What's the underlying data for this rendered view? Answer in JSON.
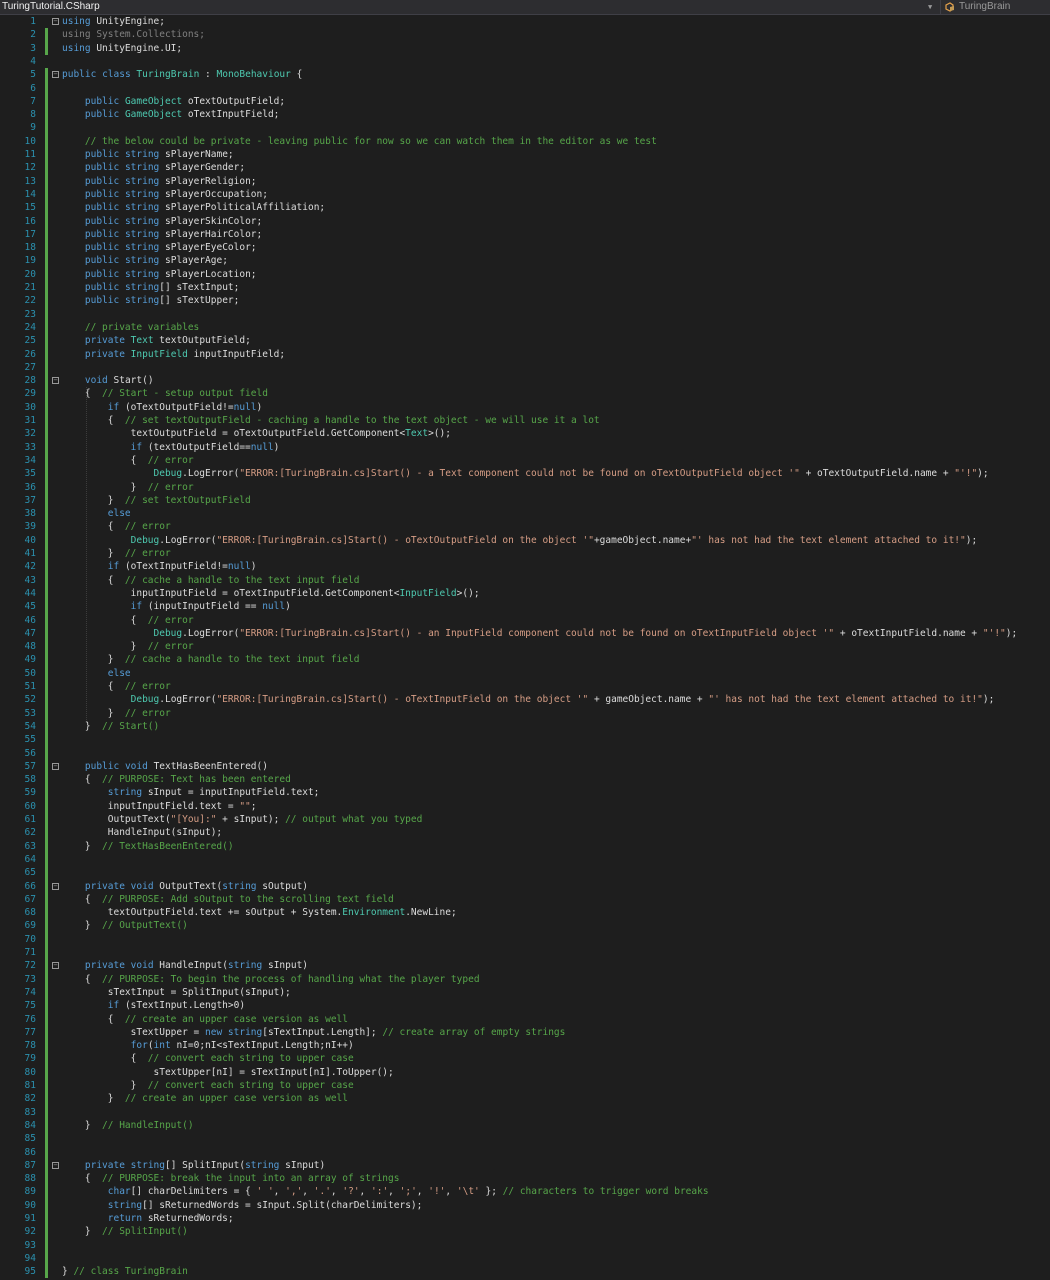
{
  "editor": {
    "file_label": "TuringTutorial.CSharp",
    "class_label": "TuringBrain",
    "class_icon": "class-icon",
    "colors": {
      "background": "#1e1e1e",
      "keyword": "#569cd6",
      "type": "#4ec9b0",
      "string": "#d69d85",
      "comment": "#57a64a",
      "line_number": "#2b91af",
      "text": "#dcdcdc"
    }
  },
  "code_lines": [
    [
      [
        "k",
        "using"
      ],
      [
        "p",
        " UnityEngine;"
      ]
    ],
    [
      [
        "g",
        "using System.Collections;"
      ]
    ],
    [
      [
        "k",
        "using"
      ],
      [
        "p",
        " UnityEngine.UI;"
      ]
    ],
    [],
    [
      [
        "k",
        "public"
      ],
      [
        "p",
        " "
      ],
      [
        "k",
        "class"
      ],
      [
        "p",
        " "
      ],
      [
        "t",
        "TuringBrain"
      ],
      [
        "p",
        " : "
      ],
      [
        "t",
        "MonoBehaviour"
      ],
      [
        "p",
        " {"
      ]
    ],
    [],
    [
      [
        "p",
        "    "
      ],
      [
        "k",
        "public"
      ],
      [
        "p",
        " "
      ],
      [
        "t",
        "GameObject"
      ],
      [
        "p",
        " oTextOutputField;"
      ]
    ],
    [
      [
        "p",
        "    "
      ],
      [
        "k",
        "public"
      ],
      [
        "p",
        " "
      ],
      [
        "t",
        "GameObject"
      ],
      [
        "p",
        " oTextInputField;"
      ]
    ],
    [],
    [
      [
        "p",
        "    "
      ],
      [
        "c",
        "// the below could be private - leaving public for now so we can watch them in the editor as we test"
      ]
    ],
    [
      [
        "p",
        "    "
      ],
      [
        "k",
        "public"
      ],
      [
        "p",
        " "
      ],
      [
        "k",
        "string"
      ],
      [
        "p",
        " sPlayerName;"
      ]
    ],
    [
      [
        "p",
        "    "
      ],
      [
        "k",
        "public"
      ],
      [
        "p",
        " "
      ],
      [
        "k",
        "string"
      ],
      [
        "p",
        " sPlayerGender;"
      ]
    ],
    [
      [
        "p",
        "    "
      ],
      [
        "k",
        "public"
      ],
      [
        "p",
        " "
      ],
      [
        "k",
        "string"
      ],
      [
        "p",
        " sPlayerReligion;"
      ]
    ],
    [
      [
        "p",
        "    "
      ],
      [
        "k",
        "public"
      ],
      [
        "p",
        " "
      ],
      [
        "k",
        "string"
      ],
      [
        "p",
        " sPlayerOccupation;"
      ]
    ],
    [
      [
        "p",
        "    "
      ],
      [
        "k",
        "public"
      ],
      [
        "p",
        " "
      ],
      [
        "k",
        "string"
      ],
      [
        "p",
        " sPlayerPoliticalAffiliation;"
      ]
    ],
    [
      [
        "p",
        "    "
      ],
      [
        "k",
        "public"
      ],
      [
        "p",
        " "
      ],
      [
        "k",
        "string"
      ],
      [
        "p",
        " sPlayerSkinColor;"
      ]
    ],
    [
      [
        "p",
        "    "
      ],
      [
        "k",
        "public"
      ],
      [
        "p",
        " "
      ],
      [
        "k",
        "string"
      ],
      [
        "p",
        " sPlayerHairColor;"
      ]
    ],
    [
      [
        "p",
        "    "
      ],
      [
        "k",
        "public"
      ],
      [
        "p",
        " "
      ],
      [
        "k",
        "string"
      ],
      [
        "p",
        " sPlayerEyeColor;"
      ]
    ],
    [
      [
        "p",
        "    "
      ],
      [
        "k",
        "public"
      ],
      [
        "p",
        " "
      ],
      [
        "k",
        "string"
      ],
      [
        "p",
        " sPlayerAge;"
      ]
    ],
    [
      [
        "p",
        "    "
      ],
      [
        "k",
        "public"
      ],
      [
        "p",
        " "
      ],
      [
        "k",
        "string"
      ],
      [
        "p",
        " sPlayerLocation;"
      ]
    ],
    [
      [
        "p",
        "    "
      ],
      [
        "k",
        "public"
      ],
      [
        "p",
        " "
      ],
      [
        "k",
        "string"
      ],
      [
        "p",
        "[] sTextInput;"
      ]
    ],
    [
      [
        "p",
        "    "
      ],
      [
        "k",
        "public"
      ],
      [
        "p",
        " "
      ],
      [
        "k",
        "string"
      ],
      [
        "p",
        "[] sTextUpper;"
      ]
    ],
    [],
    [
      [
        "p",
        "    "
      ],
      [
        "c",
        "// private variables"
      ]
    ],
    [
      [
        "p",
        "    "
      ],
      [
        "k",
        "private"
      ],
      [
        "p",
        " "
      ],
      [
        "t",
        "Text"
      ],
      [
        "p",
        " textOutputField;"
      ]
    ],
    [
      [
        "p",
        "    "
      ],
      [
        "k",
        "private"
      ],
      [
        "p",
        " "
      ],
      [
        "t",
        "InputField"
      ],
      [
        "p",
        " inputInputField;"
      ]
    ],
    [],
    [
      [
        "p",
        "    "
      ],
      [
        "k",
        "void"
      ],
      [
        "p",
        " Start()"
      ]
    ],
    [
      [
        "p",
        "    {  "
      ],
      [
        "c",
        "// Start - setup output field"
      ]
    ],
    [
      [
        "p",
        "        "
      ],
      [
        "k",
        "if"
      ],
      [
        "p",
        " (oTextOutputField!="
      ],
      [
        "k",
        "null"
      ],
      [
        "p",
        ")"
      ]
    ],
    [
      [
        "p",
        "        {  "
      ],
      [
        "c",
        "// set textOutputField - caching a handle to the text object - we will use it a lot"
      ]
    ],
    [
      [
        "p",
        "            textOutputField = oTextOutputField.GetComponent<"
      ],
      [
        "t",
        "Text"
      ],
      [
        "p",
        ">();"
      ]
    ],
    [
      [
        "p",
        "            "
      ],
      [
        "k",
        "if"
      ],
      [
        "p",
        " (textOutputField=="
      ],
      [
        "k",
        "null"
      ],
      [
        "p",
        ")"
      ]
    ],
    [
      [
        "p",
        "            {  "
      ],
      [
        "c",
        "// error"
      ]
    ],
    [
      [
        "p",
        "                "
      ],
      [
        "t",
        "Debug"
      ],
      [
        "p",
        ".LogError("
      ],
      [
        "s",
        "\"ERROR:[TuringBrain.cs]Start() - a Text component could not be found on oTextOutputField object '\""
      ],
      [
        "p",
        " + oTextOutputField.name + "
      ],
      [
        "s",
        "\"'!\""
      ],
      [
        "p",
        ");"
      ]
    ],
    [
      [
        "p",
        "            }  "
      ],
      [
        "c",
        "// error"
      ]
    ],
    [
      [
        "p",
        "        }  "
      ],
      [
        "c",
        "// set textOutputField"
      ]
    ],
    [
      [
        "p",
        "        "
      ],
      [
        "k",
        "else"
      ]
    ],
    [
      [
        "p",
        "        {  "
      ],
      [
        "c",
        "// error"
      ]
    ],
    [
      [
        "p",
        "            "
      ],
      [
        "t",
        "Debug"
      ],
      [
        "p",
        ".LogError("
      ],
      [
        "s",
        "\"ERROR:[TuringBrain.cs]Start() - oTextOutputField on the object '\""
      ],
      [
        "p",
        "+gameObject.name+"
      ],
      [
        "s",
        "\"' has not had the text element attached to it!\""
      ],
      [
        "p",
        ");"
      ]
    ],
    [
      [
        "p",
        "        }  "
      ],
      [
        "c",
        "// error"
      ]
    ],
    [
      [
        "p",
        "        "
      ],
      [
        "k",
        "if"
      ],
      [
        "p",
        " (oTextInputField!="
      ],
      [
        "k",
        "null"
      ],
      [
        "p",
        ")"
      ]
    ],
    [
      [
        "p",
        "        {  "
      ],
      [
        "c",
        "// cache a handle to the text input field"
      ]
    ],
    [
      [
        "p",
        "            inputInputField = oTextInputField.GetComponent<"
      ],
      [
        "t",
        "InputField"
      ],
      [
        "p",
        ">();"
      ]
    ],
    [
      [
        "p",
        "            "
      ],
      [
        "k",
        "if"
      ],
      [
        "p",
        " (inputInputField == "
      ],
      [
        "k",
        "null"
      ],
      [
        "p",
        ")"
      ]
    ],
    [
      [
        "p",
        "            {  "
      ],
      [
        "c",
        "// error"
      ]
    ],
    [
      [
        "p",
        "                "
      ],
      [
        "t",
        "Debug"
      ],
      [
        "p",
        ".LogError("
      ],
      [
        "s",
        "\"ERROR:[TuringBrain.cs]Start() - an InputField component could not be found on oTextInputField object '\""
      ],
      [
        "p",
        " + oTextInputField.name + "
      ],
      [
        "s",
        "\"'!\""
      ],
      [
        "p",
        ");"
      ]
    ],
    [
      [
        "p",
        "            }  "
      ],
      [
        "c",
        "// error"
      ]
    ],
    [
      [
        "p",
        "        }  "
      ],
      [
        "c",
        "// cache a handle to the text input field"
      ]
    ],
    [
      [
        "p",
        "        "
      ],
      [
        "k",
        "else"
      ]
    ],
    [
      [
        "p",
        "        {  "
      ],
      [
        "c",
        "// error"
      ]
    ],
    [
      [
        "p",
        "            "
      ],
      [
        "t",
        "Debug"
      ],
      [
        "p",
        ".LogError("
      ],
      [
        "s",
        "\"ERROR:[TuringBrain.cs]Start() - oTextInputField on the object '\""
      ],
      [
        "p",
        " + gameObject.name + "
      ],
      [
        "s",
        "\"' has not had the text element attached to it!\""
      ],
      [
        "p",
        ");"
      ]
    ],
    [
      [
        "p",
        "        }  "
      ],
      [
        "c",
        "// error"
      ]
    ],
    [
      [
        "p",
        "    }  "
      ],
      [
        "c",
        "// Start()"
      ]
    ],
    [],
    [],
    [
      [
        "p",
        "    "
      ],
      [
        "k",
        "public"
      ],
      [
        "p",
        " "
      ],
      [
        "k",
        "void"
      ],
      [
        "p",
        " TextHasBeenEntered()"
      ]
    ],
    [
      [
        "p",
        "    {  "
      ],
      [
        "c",
        "// PURPOSE: Text has been entered"
      ]
    ],
    [
      [
        "p",
        "        "
      ],
      [
        "k",
        "string"
      ],
      [
        "p",
        " sInput = inputInputField.text;"
      ]
    ],
    [
      [
        "p",
        "        inputInputField.text = "
      ],
      [
        "s",
        "\"\""
      ],
      [
        "p",
        ";"
      ]
    ],
    [
      [
        "p",
        "        OutputText("
      ],
      [
        "s",
        "\"[You]:\""
      ],
      [
        "p",
        " + sInput); "
      ],
      [
        "c",
        "// output what you typed"
      ]
    ],
    [
      [
        "p",
        "        HandleInput(sInput);"
      ]
    ],
    [
      [
        "p",
        "    }  "
      ],
      [
        "c",
        "// TextHasBeenEntered()"
      ]
    ],
    [],
    [],
    [
      [
        "p",
        "    "
      ],
      [
        "k",
        "private"
      ],
      [
        "p",
        " "
      ],
      [
        "k",
        "void"
      ],
      [
        "p",
        " OutputText("
      ],
      [
        "k",
        "string"
      ],
      [
        "p",
        " sOutput)"
      ]
    ],
    [
      [
        "p",
        "    {  "
      ],
      [
        "c",
        "// PURPOSE: Add sOutput to the scrolling text field"
      ]
    ],
    [
      [
        "p",
        "        textOutputField.text += sOutput + System."
      ],
      [
        "t",
        "Environment"
      ],
      [
        "p",
        ".NewLine;"
      ]
    ],
    [
      [
        "p",
        "    }  "
      ],
      [
        "c",
        "// OutputText()"
      ]
    ],
    [],
    [],
    [
      [
        "p",
        "    "
      ],
      [
        "k",
        "private"
      ],
      [
        "p",
        " "
      ],
      [
        "k",
        "void"
      ],
      [
        "p",
        " HandleInput("
      ],
      [
        "k",
        "string"
      ],
      [
        "p",
        " sInput)"
      ]
    ],
    [
      [
        "p",
        "    {  "
      ],
      [
        "c",
        "// PURPOSE: To begin the process of handling what the player typed"
      ]
    ],
    [
      [
        "p",
        "        sTextInput = SplitInput(sInput);"
      ]
    ],
    [
      [
        "p",
        "        "
      ],
      [
        "k",
        "if"
      ],
      [
        "p",
        " (sTextInput.Length>0)"
      ]
    ],
    [
      [
        "p",
        "        {  "
      ],
      [
        "c",
        "// create an upper case version as well"
      ]
    ],
    [
      [
        "p",
        "            sTextUpper = "
      ],
      [
        "k",
        "new"
      ],
      [
        "p",
        " "
      ],
      [
        "k",
        "string"
      ],
      [
        "p",
        "[sTextInput.Length]; "
      ],
      [
        "c",
        "// create array of empty strings"
      ]
    ],
    [
      [
        "p",
        "            "
      ],
      [
        "k",
        "for"
      ],
      [
        "p",
        "("
      ],
      [
        "k",
        "int"
      ],
      [
        "p",
        " nI=0;nI<sTextInput.Length;nI++)"
      ]
    ],
    [
      [
        "p",
        "            {  "
      ],
      [
        "c",
        "// convert each string to upper case"
      ]
    ],
    [
      [
        "p",
        "                sTextUpper[nI] = sTextInput[nI].ToUpper();"
      ]
    ],
    [
      [
        "p",
        "            }  "
      ],
      [
        "c",
        "// convert each string to upper case"
      ]
    ],
    [
      [
        "p",
        "        }  "
      ],
      [
        "c",
        "// create an upper case version as well"
      ]
    ],
    [],
    [
      [
        "p",
        "    }  "
      ],
      [
        "c",
        "// HandleInput()"
      ]
    ],
    [],
    [],
    [
      [
        "p",
        "    "
      ],
      [
        "k",
        "private"
      ],
      [
        "p",
        " "
      ],
      [
        "k",
        "string"
      ],
      [
        "p",
        "[] SplitInput("
      ],
      [
        "k",
        "string"
      ],
      [
        "p",
        " sInput)"
      ]
    ],
    [
      [
        "p",
        "    {  "
      ],
      [
        "c",
        "// PURPOSE: break the input into an array of strings"
      ]
    ],
    [
      [
        "p",
        "        "
      ],
      [
        "k",
        "char"
      ],
      [
        "p",
        "[] charDelimiters = { "
      ],
      [
        "s",
        "' '"
      ],
      [
        "p",
        ", "
      ],
      [
        "s",
        "','"
      ],
      [
        "p",
        ", "
      ],
      [
        "s",
        "'.'"
      ],
      [
        "p",
        ", "
      ],
      [
        "s",
        "'?'"
      ],
      [
        "p",
        ", "
      ],
      [
        "s",
        "':'"
      ],
      [
        "p",
        ", "
      ],
      [
        "s",
        "';'"
      ],
      [
        "p",
        ", "
      ],
      [
        "s",
        "'!'"
      ],
      [
        "p",
        ", "
      ],
      [
        "s",
        "'\\t'"
      ],
      [
        "p",
        " }; "
      ],
      [
        "c",
        "// characters to trigger word breaks"
      ]
    ],
    [
      [
        "p",
        "        "
      ],
      [
        "k",
        "string"
      ],
      [
        "p",
        "[] sReturnedWords = sInput.Split(charDelimiters);"
      ]
    ],
    [
      [
        "p",
        "        "
      ],
      [
        "k",
        "return"
      ],
      [
        "p",
        " sReturnedWords;"
      ]
    ],
    [
      [
        "p",
        "    }  "
      ],
      [
        "c",
        "// SplitInput()"
      ]
    ],
    [],
    [],
    [
      [
        "p",
        "} "
      ],
      [
        "c",
        "// class TuringBrain"
      ]
    ]
  ]
}
